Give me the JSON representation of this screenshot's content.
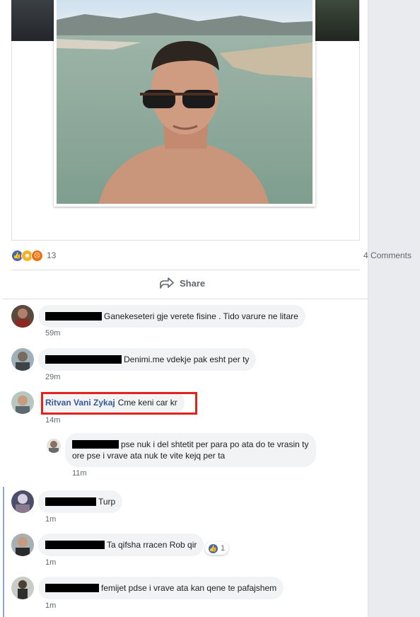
{
  "post": {
    "reaction_count": "13",
    "comments_link": "4 Comments",
    "share_label": "Share",
    "reaction_icons": [
      "like-icon",
      "haha-icon",
      "angry-icon"
    ]
  },
  "comments": [
    {
      "author": "",
      "text": "Ganekeseteri gje verete fisine . Tido varure ne litare",
      "time": "59m"
    },
    {
      "author": "",
      "text": "Denimi.me vdekje pak esht per ty",
      "time": "29m"
    },
    {
      "author": "Ritvan Vani Zykaj",
      "text": "Cme keni car kr",
      "time": "14m",
      "highlighted": true
    },
    {
      "author": "",
      "text": "pse nuk i del shtetit per para po ata do te vrasin ty",
      "text_line2": "ore pse i vrave ata nuk te vite kejq per ta",
      "time": "11m",
      "reply": true
    },
    {
      "author": "",
      "text": "Turp",
      "time": "1m"
    },
    {
      "author": "",
      "text": "Ta qifsha rracen Rob qir",
      "time": "1m",
      "likes": "1"
    },
    {
      "author": "",
      "text": "femijet pdse i vrave ata kan qene te pafajshem",
      "time": "1m"
    }
  ],
  "colors": {
    "link_blue": "#385898",
    "highlight_red": "#e0231b",
    "bubble_bg": "#f2f3f5"
  }
}
